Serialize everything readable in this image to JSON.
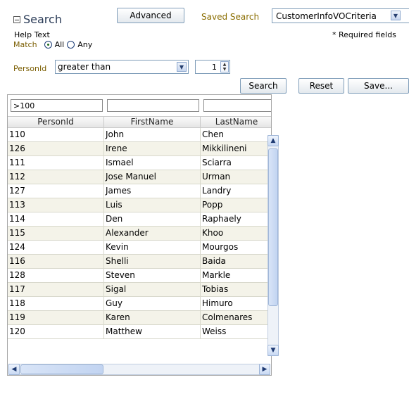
{
  "header": {
    "title": "Search",
    "advanced_label": "Advanced",
    "saved_search_label": "Saved Search",
    "saved_search_value": "CustomerInfoVOCriteria",
    "help_text": "Help Text",
    "required_text": "* Required fields"
  },
  "match": {
    "label": "Match",
    "options": [
      "All",
      "Any"
    ],
    "selected": "All"
  },
  "criteria": {
    "field_label": "PersonId",
    "operator": "greater than",
    "value": "1"
  },
  "actions": {
    "search": "Search",
    "reset": "Reset",
    "save": "Save..."
  },
  "table": {
    "filters": [
      ">100",
      "",
      ""
    ],
    "columns": [
      "PersonId",
      "FirstName",
      "LastName"
    ],
    "rows": [
      [
        "110",
        "John",
        "Chen"
      ],
      [
        "126",
        "Irene",
        "Mikkilineni"
      ],
      [
        "111",
        "Ismael",
        "Sciarra"
      ],
      [
        "112",
        "Jose Manuel",
        "Urman"
      ],
      [
        "127",
        "James",
        "Landry"
      ],
      [
        "113",
        "Luis",
        "Popp"
      ],
      [
        "114",
        "Den",
        "Raphaely"
      ],
      [
        "115",
        "Alexander",
        "Khoo"
      ],
      [
        "124",
        "Kevin",
        "Mourgos"
      ],
      [
        "116",
        "Shelli",
        "Baida"
      ],
      [
        "128",
        "Steven",
        "Markle"
      ],
      [
        "117",
        "Sigal",
        "Tobias"
      ],
      [
        "118",
        "Guy",
        "Himuro"
      ],
      [
        "119",
        "Karen",
        "Colmenares"
      ],
      [
        "120",
        "Matthew",
        "Weiss"
      ]
    ]
  }
}
